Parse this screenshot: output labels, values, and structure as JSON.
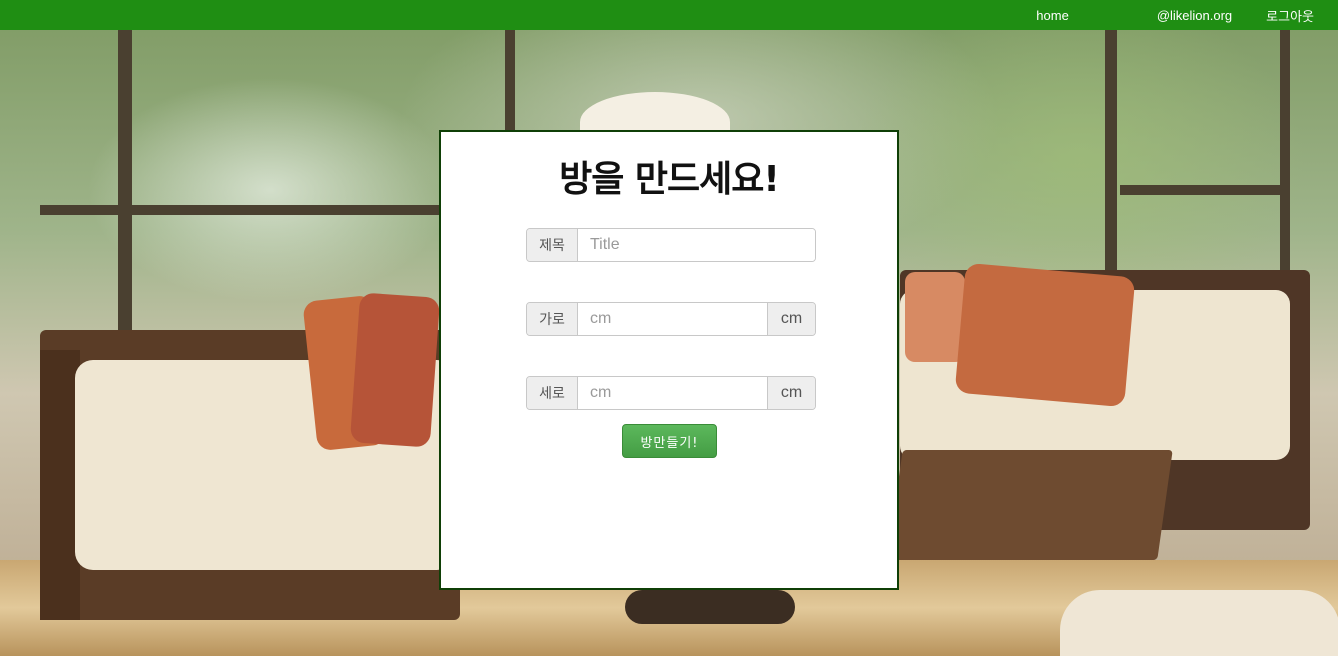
{
  "nav": {
    "home": "home",
    "email": "@likelion.org",
    "logout": "로그아웃"
  },
  "form": {
    "heading": "방을 만드세요!",
    "title_label": "제목",
    "title_placeholder": "Title",
    "width_label": "가로",
    "width_placeholder": "cm",
    "width_unit": "cm",
    "height_label": "세로",
    "height_placeholder": "cm",
    "height_unit": "cm",
    "submit_label": "방만들기!"
  },
  "colors": {
    "navbar": "#1f8e13",
    "panel_border": "#0f3f06",
    "button": "#4cae4c"
  },
  "background": "living-room-photo"
}
